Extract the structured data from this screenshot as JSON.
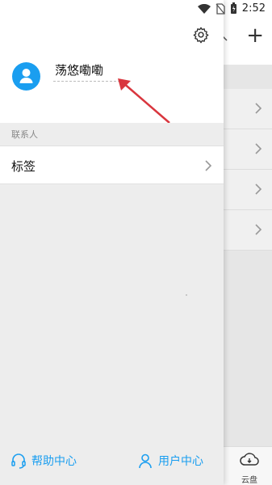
{
  "status_bar": {
    "time": "2:52"
  },
  "drawer": {
    "username": "荡悠嘞嘞",
    "section_label": "联系人",
    "tags_label": "标签",
    "footer": {
      "help_label": "帮助中心",
      "user_center_label": "用户中心"
    }
  },
  "background_app": {
    "cloud_tab_label": "云盘",
    "add_button_label": "+"
  },
  "colors": {
    "accent": "#1a9ef0",
    "arrow": "#d9363e"
  }
}
